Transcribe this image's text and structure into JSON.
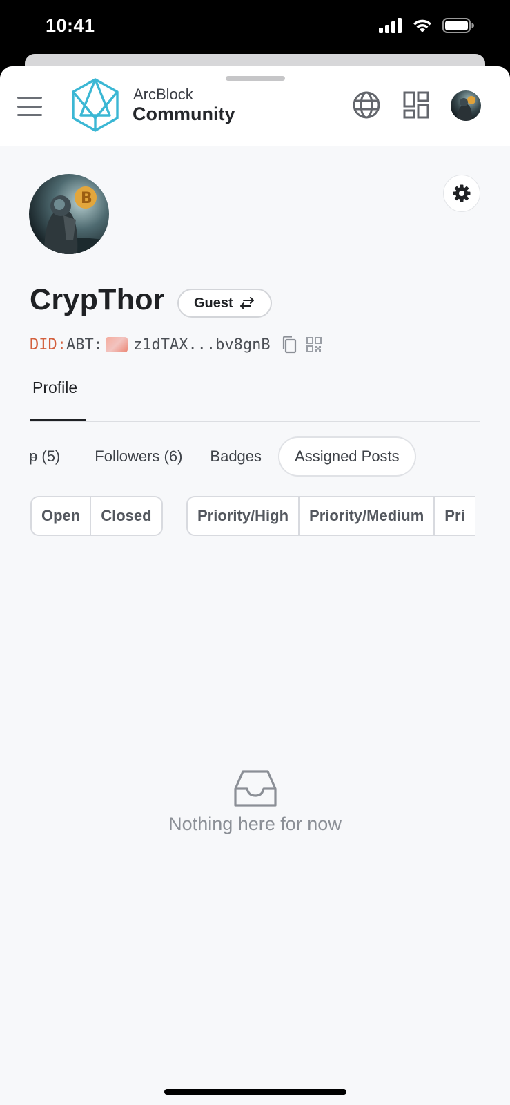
{
  "status_bar": {
    "time": "10:41"
  },
  "header": {
    "brand_top": "ArcBlock",
    "brand_main": "Community",
    "icons": [
      "menu-icon",
      "globe-icon",
      "apps-grid-icon",
      "avatar"
    ]
  },
  "profile": {
    "username": "CrypThor",
    "role_label": "Guest",
    "did_prefix": "DID:",
    "did_type": "ABT:",
    "did_address": "z1dTAX...bv8gnB"
  },
  "tabs": {
    "profile": "Profile"
  },
  "subtabs": {
    "partial": "(5)",
    "followers": "Followers (6)",
    "badges": "Badges",
    "assigned_posts": "Assigned Posts"
  },
  "filters": {
    "status": [
      "Open",
      "Closed"
    ],
    "priority": [
      "Priority/High",
      "Priority/Medium",
      "Pri"
    ]
  },
  "empty_state": {
    "message": "Nothing here for now"
  },
  "colors": {
    "accent_did": "#d35f3c",
    "logo": "#3bb7d4",
    "background": "#f7f8fa"
  }
}
